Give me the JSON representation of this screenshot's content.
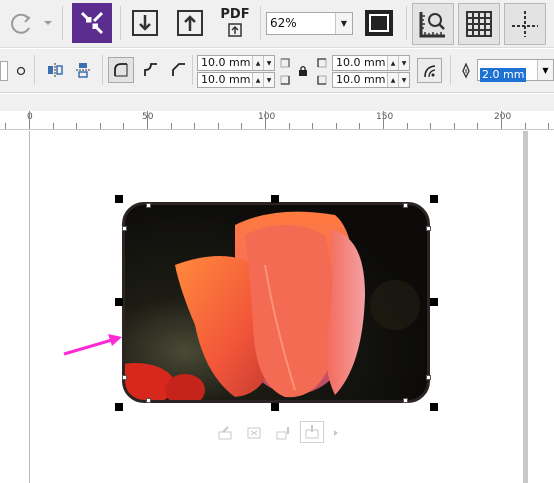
{
  "toolbar": {
    "zoom_level": "62%",
    "pdf_label": "PDF",
    "icons": [
      "redo-icon",
      "redo-dropdown-icon",
      "zoom-fit-icon",
      "import-icon",
      "export-icon",
      "publish-pdf-icon",
      "full-screen-icon",
      "rulers-icon",
      "grid-icon",
      "guidelines-icon"
    ]
  },
  "property_bar": {
    "corner_radius_top_left": "10.0 mm",
    "corner_radius_bottom_left": "10.0 mm",
    "corner_radius_top_right": "10.0 mm",
    "corner_radius_bottom_right": "10.0 mm",
    "outline_width": "2.0 mm",
    "icons": [
      "round-corner-icon",
      "scalloped-corner-icon",
      "chamfered-corner-icon",
      "lock-ratio-icon",
      "relative-corner-scaling-icon",
      "outline-pen-icon"
    ]
  },
  "ruler": {
    "labels": [
      "0",
      "50",
      "100",
      "150",
      "200"
    ]
  },
  "canvas": {
    "arrow_color": "#ff2ad4",
    "accent": "#5b2d8e",
    "selected_object": "rounded-rectangle-photo"
  },
  "context_toolbar": {
    "icons": [
      "edit-bitmap-icon",
      "crop-bitmap-icon",
      "trace-bitmap-icon",
      "powerclip-icon",
      "more-icon"
    ]
  }
}
